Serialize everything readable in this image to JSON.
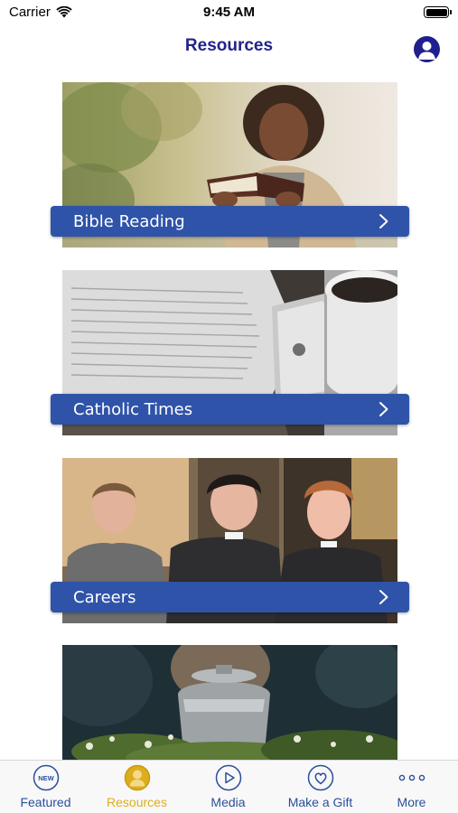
{
  "status_bar": {
    "carrier": "Carrier",
    "time": "9:45 AM"
  },
  "nav": {
    "title": "Resources"
  },
  "cards": [
    {
      "label": "Bible Reading"
    },
    {
      "label": "Catholic Times"
    },
    {
      "label": "Careers"
    },
    {
      "label": ""
    }
  ],
  "tabs": [
    {
      "label": "Featured",
      "badge": "NEW",
      "icon": "new-badge-icon",
      "active": false
    },
    {
      "label": "Resources",
      "icon": "user-circle-icon",
      "active": true
    },
    {
      "label": "Media",
      "icon": "play-circle-icon",
      "active": false
    },
    {
      "label": "Make a Gift",
      "icon": "heart-circle-icon",
      "active": false
    },
    {
      "label": "More",
      "icon": "more-dots-icon",
      "active": false
    }
  ],
  "colors": {
    "accent_blue": "#2f53a8",
    "title_navy": "#23238a",
    "active_gold": "#dcae1d",
    "tab_blue": "#2a4f9a"
  }
}
